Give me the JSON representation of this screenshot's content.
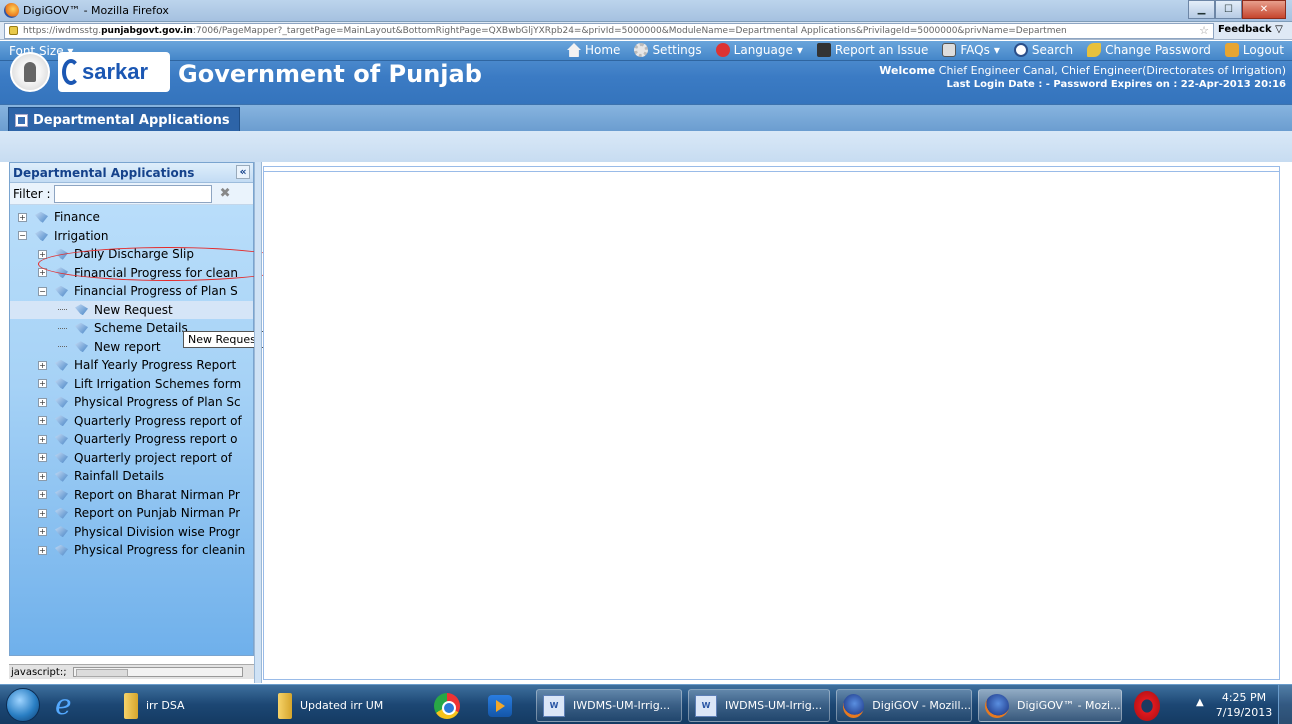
{
  "window": {
    "title": "DigiGOV™ - Mozilla Firefox",
    "controls": [
      "minimize",
      "maximize",
      "close"
    ]
  },
  "browser": {
    "url_prefix": "https://iwdmsstg.",
    "url_domain": "punjabgovt.gov.in",
    "url_rest": ":7006/PageMapper?_targetPage=MainLayout&BottomRightPage=QXBwbGljYXRpb24=&privId=5000000&ModuleName=Departmental Applications&PrivilageId=5000000&privName=Departmen",
    "feedback_label": "Feedback"
  },
  "header": {
    "font_size_label": "Font Size",
    "nav": [
      {
        "label": "Home",
        "icon": "home-icon"
      },
      {
        "label": "Settings",
        "icon": "gear-icon"
      },
      {
        "label": "Language",
        "icon": "language-icon"
      },
      {
        "label": "Report an Issue",
        "icon": "report-icon"
      },
      {
        "label": "FAQs",
        "icon": "faq-icon"
      },
      {
        "label": "Search",
        "icon": "search-icon"
      },
      {
        "label": "Change Password",
        "icon": "key-icon"
      },
      {
        "label": "Logout",
        "icon": "logout-icon"
      }
    ],
    "brand_text": "sarkar",
    "gov_title": "Government of Punjab",
    "welcome_prefix": "Welcome",
    "welcome_user": "Chief Engineer Canal, Chief Engineer(Directorates of Irrigation)",
    "last_login": "Last Login Date : -  Password Expires on : 22-Apr-2013 20:16"
  },
  "app_tab": {
    "label": "Departmental Applications"
  },
  "left_panel": {
    "title": "Departmental Applications",
    "collapse_glyph": "«",
    "filter_label": "Filter :",
    "filter_value": "",
    "clear_glyph": "✖",
    "tree": [
      {
        "label": "Finance",
        "level": 0,
        "toggle": "+"
      },
      {
        "label": "Irrigation",
        "level": 0,
        "toggle": "−"
      },
      {
        "label": "Daily Discharge Slip",
        "level": 1,
        "toggle": "+"
      },
      {
        "label": "Financial Progress for clean",
        "level": 1,
        "toggle": "+"
      },
      {
        "label": "Financial Progress of Plan S",
        "level": 1,
        "toggle": "−"
      },
      {
        "label": "New Request",
        "level": 2,
        "toggle": ""
      },
      {
        "label": "Scheme Details",
        "level": 2,
        "toggle": ""
      },
      {
        "label": "New report",
        "level": 2,
        "toggle": ""
      },
      {
        "label": "Half Yearly Progress Report",
        "level": 1,
        "toggle": "+"
      },
      {
        "label": "Lift Irrigation Schemes form",
        "level": 1,
        "toggle": "+"
      },
      {
        "label": "Physical Progress of Plan Sc",
        "level": 1,
        "toggle": "+"
      },
      {
        "label": "Quarterly Progress report of",
        "level": 1,
        "toggle": "+"
      },
      {
        "label": "Quarterly Progress report o",
        "level": 1,
        "toggle": "+"
      },
      {
        "label": "Quarterly project report of",
        "level": 1,
        "toggle": "+"
      },
      {
        "label": "Rainfall Details",
        "level": 1,
        "toggle": "+"
      },
      {
        "label": "Report on Bharat Nirman Pr",
        "level": 1,
        "toggle": "+"
      },
      {
        "label": "Report on Punjab Nirman Pr",
        "level": 1,
        "toggle": "+"
      },
      {
        "label": "Physical Division wise Progr",
        "level": 1,
        "toggle": "+"
      },
      {
        "label": "Physical Progress for cleanin",
        "level": 1,
        "toggle": "+"
      }
    ],
    "tooltip": "New Request",
    "status_text": "javascript:;"
  },
  "taskbar": {
    "items": [
      {
        "label": "irr DSA",
        "icon": "folder-icon"
      },
      {
        "label": "Updated irr UM",
        "icon": "folder-icon"
      },
      {
        "label": "IWDMS-UM-Irrig...",
        "icon": "word-icon"
      },
      {
        "label": "IWDMS-UM-Irrig...",
        "icon": "word-icon"
      },
      {
        "label": "DigiGOV - Mozill...",
        "icon": "firefox-icon"
      },
      {
        "label": "DigiGOV™ - Mozi...",
        "icon": "firefox-icon"
      }
    ],
    "time": "4:25 PM",
    "date": "7/19/2013"
  }
}
